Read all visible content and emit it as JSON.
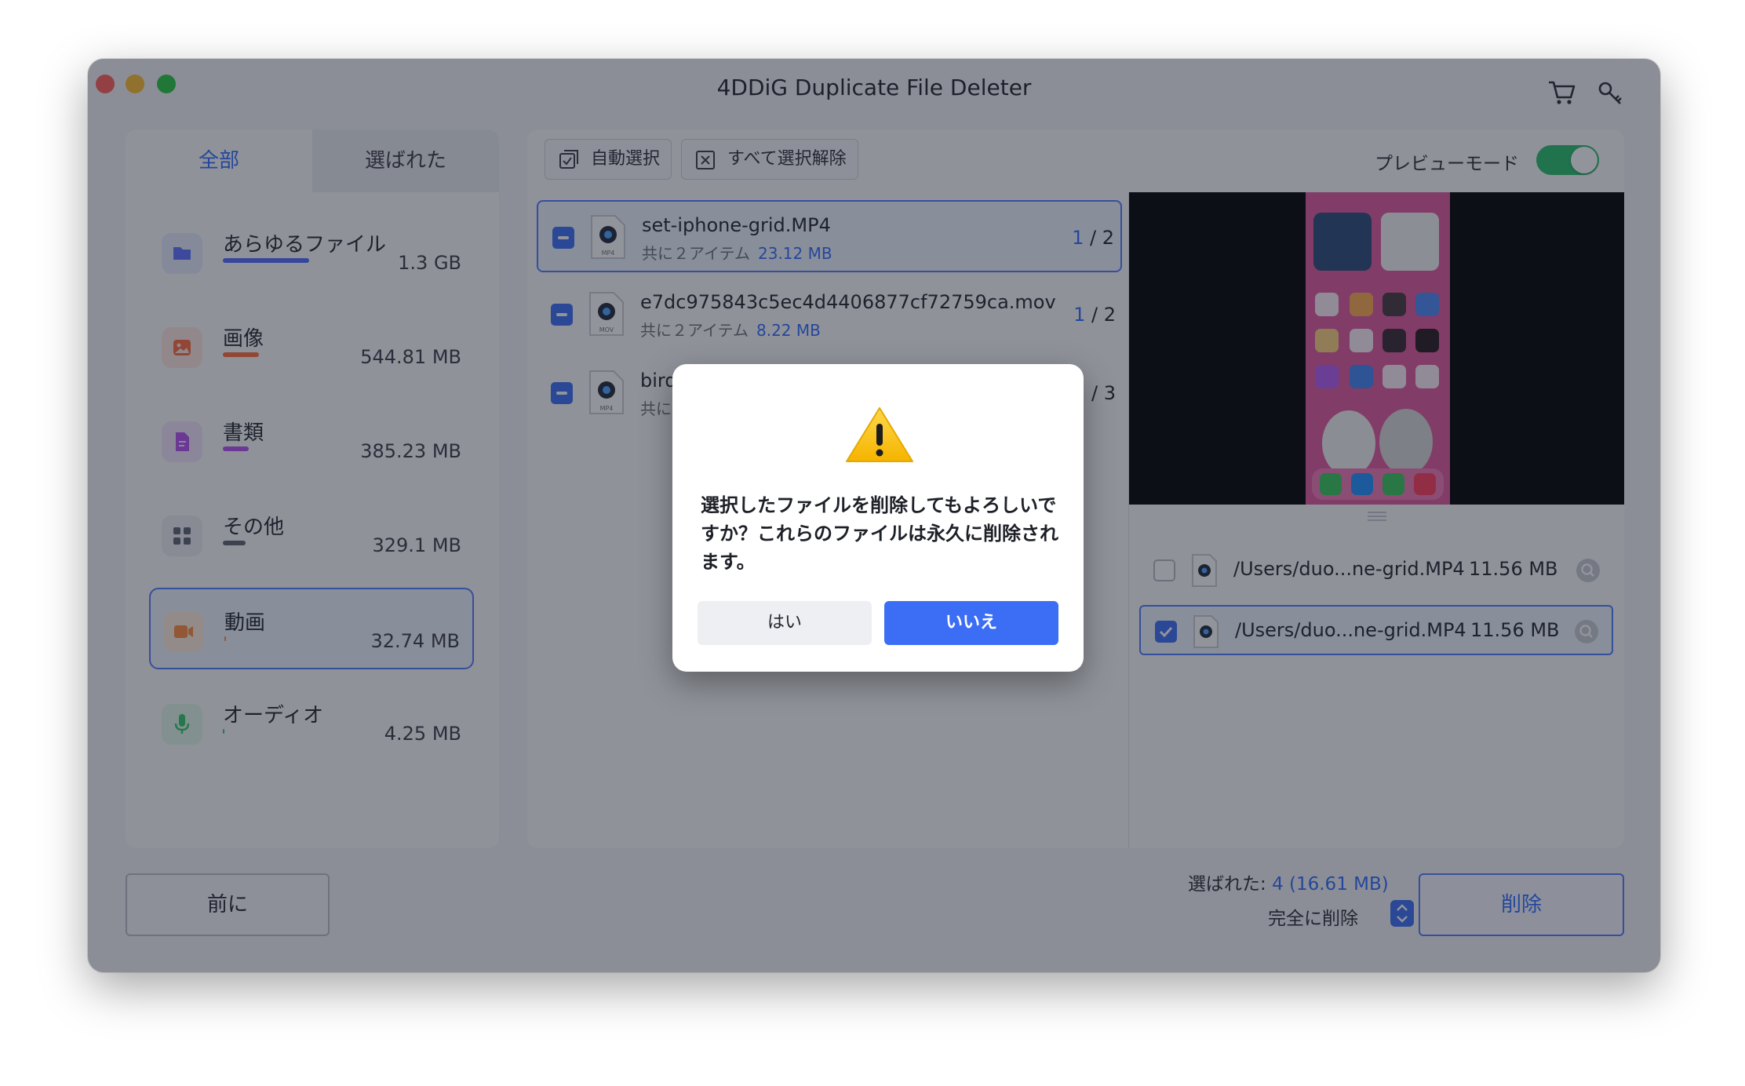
{
  "app": {
    "title": "4DDiG Duplicate File Deleter"
  },
  "sidebar": {
    "tabs": [
      "全部",
      "選ばれた"
    ],
    "categories": [
      {
        "name": "あらゆるファイル",
        "size": "1.3 GB",
        "fill": 0.5,
        "color": "#4f6cff",
        "icon": "folder-icon"
      },
      {
        "name": "画像",
        "size": "544.81 MB",
        "fill": 0.21,
        "color": "#ff6a3d",
        "icon": "image-icon"
      },
      {
        "name": "書類",
        "size": "385.23 MB",
        "fill": 0.15,
        "color": "#b44ff0",
        "icon": "document-icon"
      },
      {
        "name": "その他",
        "size": "329.1 MB",
        "fill": 0.13,
        "color": "#5d6270",
        "icon": "grid-icon"
      },
      {
        "name": "動画",
        "size": "32.74 MB",
        "fill": 0.01,
        "color": "#ff8a3d",
        "icon": "video-icon"
      },
      {
        "name": "オーディオ",
        "size": "4.25 MB",
        "fill": 0.003,
        "color": "#33c76a",
        "icon": "microphone-icon"
      }
    ]
  },
  "toolbar": {
    "auto_select": "自動選択",
    "deselect_all": "すべて選択解除",
    "preview_mode": "プレビューモード"
  },
  "files": [
    {
      "name": "set-iphone-grid.MP4",
      "sub": "共に２アイテム",
      "size": "23.12 MB",
      "selected_count": "1",
      "total": " / 2",
      "ext": "MP4"
    },
    {
      "name": "e7dc975843c5ec4d4406877cf72759ca.mov",
      "sub": "共に２アイテム",
      "size": "8.22 MB",
      "selected_count": "1",
      "total": " / 2",
      "ext": "MOV"
    },
    {
      "name": "bird",
      "sub": "共に",
      "size": "",
      "selected_count": "",
      "total": " / 3",
      "ext": "MP4"
    }
  ],
  "locations": [
    {
      "path": "/Users/duo...ne-grid.MP4",
      "size": "11.56 MB"
    },
    {
      "path": "/Users/duo...ne-grid.MP4",
      "size": "11.56 MB"
    }
  ],
  "footer": {
    "prev": "前に",
    "selected_label": "選ばれた:",
    "selected_value": "4 (16.61 MB)",
    "mode": "完全に削除",
    "delete": "削除"
  },
  "dialog": {
    "message": "選択したファイルを削除してもよろしいですか？これらのファイルは永久に削除されます。",
    "yes": "はい",
    "no": "いいえ"
  }
}
